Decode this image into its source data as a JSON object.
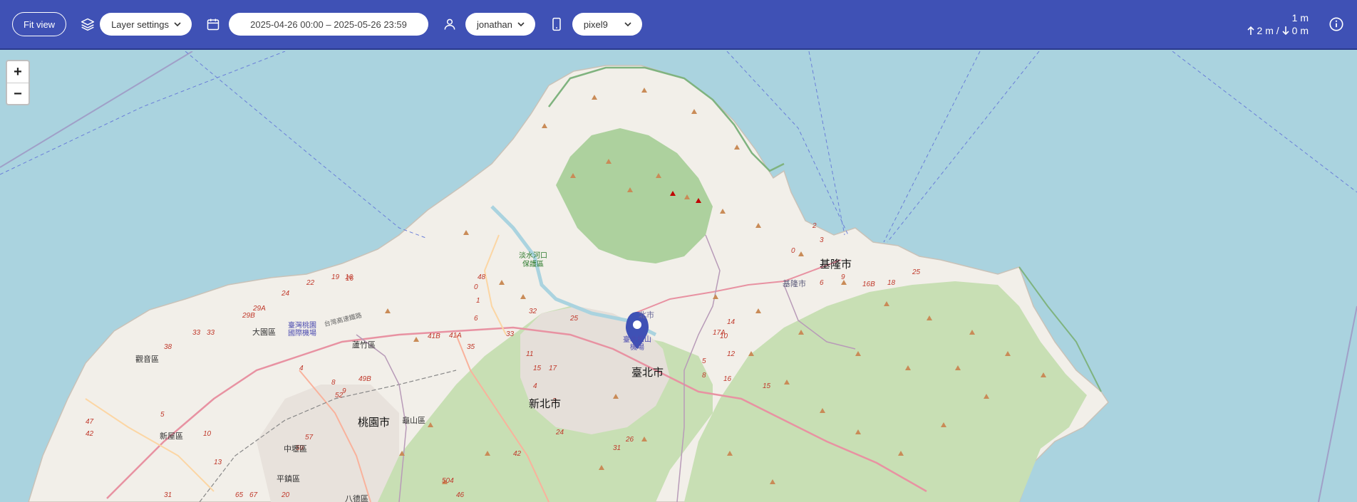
{
  "toolbar": {
    "fit_view_label": "Fit view",
    "layer_settings_label": "Layer settings",
    "date_range": "2025-04-26 00:00 – 2025-05-26 23:59",
    "user": "jonathan",
    "device": "pixel9",
    "accuracy": "1 m",
    "altitude_up": "2 m /",
    "altitude_down": "0 m",
    "icons": [
      "layers-icon",
      "calendar-icon",
      "user-icon",
      "phone-icon",
      "arrow-up-icon",
      "arrow-down-icon",
      "info-icon",
      "chevron-down-icon"
    ]
  },
  "map": {
    "zoom_in": "+",
    "zoom_out": "−",
    "marker": {
      "name": "location-pin",
      "color": "#3f51b5"
    },
    "labels": {
      "keelung": "基隆市",
      "keelung_port": "基隆市",
      "taipei": "臺北市",
      "taipei_n": "北市",
      "new_taipei": "新北市",
      "taoyuan": "桃園市",
      "airport_taoyuan": "臺灣桃園\n國際機場",
      "airport_songshan": "臺北松山\n機場",
      "tamsui": "淡水河口\n保護區",
      "dayuan": "大園區",
      "luzhu": "蘆竹區",
      "guanyin": "觀音區",
      "xinwu": "新屋區",
      "zhongli": "中壢區",
      "pingzhen": "平鎮區",
      "bade": "八德區",
      "guishan": "龜山區",
      "expressway": "台灣高速鐵路"
    },
    "route_numbers": [
      "19",
      "16",
      "22",
      "24",
      "29A",
      "29B",
      "33",
      "33",
      "38",
      "47",
      "42",
      "5",
      "10",
      "13",
      "4",
      "8",
      "9",
      "49B",
      "52",
      "57",
      "59",
      "31",
      "65",
      "67",
      "20",
      "16",
      "41B",
      "41A",
      "35",
      "33",
      "32",
      "11",
      "15",
      "17",
      "25",
      "4",
      "3",
      "42",
      "24",
      "26",
      "31",
      "504",
      "46",
      "48",
      "0",
      "1",
      "6",
      "5",
      "10",
      "14",
      "16",
      "17A",
      "12",
      "8",
      "15",
      "0",
      "2",
      "3",
      "6",
      "9",
      "16B",
      "18",
      "25"
    ]
  },
  "colors": {
    "toolbar": "#3f51b5",
    "sea": "#aad3df",
    "land": "#f2efe9",
    "forest": "#add19e",
    "marker": "#3f51b5"
  }
}
